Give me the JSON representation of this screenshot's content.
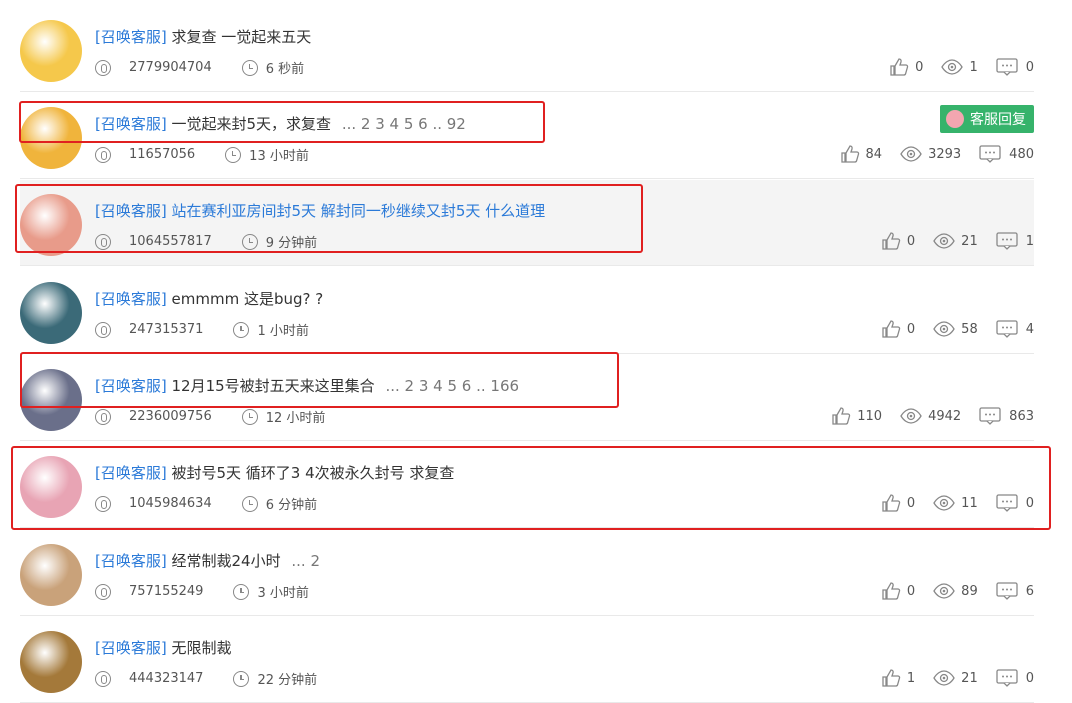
{
  "tag_label": "[召唤客服]",
  "badge_label": "客服回复",
  "posts": [
    {
      "title": "求复查 一觉起来五天",
      "pages": "",
      "user": "2779904704",
      "time": "6 秒前",
      "likes": "0",
      "views": "1",
      "comments": "0",
      "badge": false,
      "highlight": false,
      "avatar": "#f5c84b"
    },
    {
      "title": "一觉起来封5天，求复查",
      "pages": "... 2 3 4 5 6 .. 92",
      "user": "11657056",
      "time": "13 小时前",
      "likes": "84",
      "views": "3293",
      "comments": "480",
      "badge": true,
      "highlight": false,
      "avatar": "#f0b43c"
    },
    {
      "title": "站在赛利亚房间封5天 解封同一秒继续又封5天 什么道理",
      "pages": "",
      "user": "1064557817",
      "time": "9 分钟前",
      "likes": "0",
      "views": "21",
      "comments": "1",
      "badge": false,
      "highlight": true,
      "avatar": "#e89b8a"
    },
    {
      "title": "emmmm 这是bug? ?",
      "pages": "",
      "user": "247315371",
      "time": "1 小时前",
      "likes": "0",
      "views": "58",
      "comments": "4",
      "badge": false,
      "highlight": false,
      "avatar": "#3b6a78"
    },
    {
      "title": "12月15号被封五天来这里集合",
      "pages": "... 2 3 4 5 6 .. 166",
      "user": "2236009756",
      "time": "12 小时前",
      "likes": "110",
      "views": "4942",
      "comments": "863",
      "badge": false,
      "highlight": false,
      "avatar": "#6a6f8a"
    },
    {
      "title": "被封号5天 循环了3 4次被永久封号 求复查",
      "pages": "",
      "user": "1045984634",
      "time": "6 分钟前",
      "likes": "0",
      "views": "11",
      "comments": "0",
      "badge": false,
      "highlight": false,
      "avatar": "#e8a4b4"
    },
    {
      "title": "经常制裁24小时",
      "pages": "... 2",
      "user": "757155249",
      "time": "3 小时前",
      "likes": "0",
      "views": "89",
      "comments": "6",
      "badge": false,
      "highlight": false,
      "avatar": "#c9a27a"
    },
    {
      "title": "无限制裁",
      "pages": "",
      "user": "444323147",
      "time": "22 分钟前",
      "likes": "1",
      "views": "21",
      "comments": "0",
      "badge": false,
      "highlight": false,
      "avatar": "#a4793a"
    }
  ]
}
